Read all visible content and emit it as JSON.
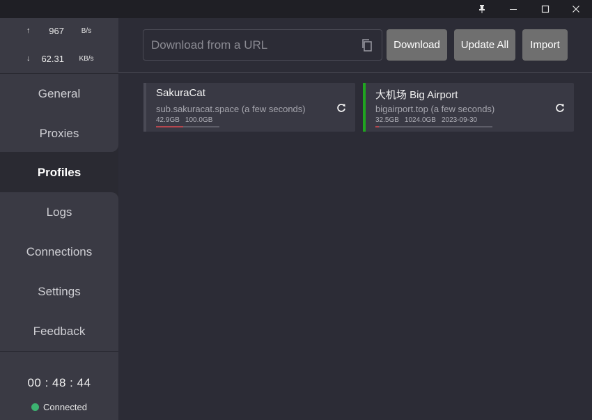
{
  "titlebar": {
    "icons": [
      "pin-icon",
      "minimize-icon",
      "maximize-icon",
      "close-icon"
    ]
  },
  "traffic": {
    "up_arrow": "↑",
    "up_value": "967",
    "up_unit": "B/s",
    "down_arrow": "↓",
    "down_value": "62.31",
    "down_unit": "KB/s"
  },
  "nav": {
    "items": [
      {
        "label": "General"
      },
      {
        "label": "Proxies"
      },
      {
        "label": "Profiles"
      },
      {
        "label": "Logs"
      },
      {
        "label": "Connections"
      },
      {
        "label": "Settings"
      },
      {
        "label": "Feedback"
      }
    ],
    "active": "Profiles"
  },
  "status": {
    "timer": "00 : 48 : 44",
    "connection": "Connected",
    "connection_color": "#3cb371"
  },
  "toolbar": {
    "url_placeholder": "Download from a URL",
    "download_label": "Download",
    "update_all_label": "Update All",
    "import_label": "Import"
  },
  "profiles": [
    {
      "name": "SakuraCat",
      "subtitle": "sub.sakuracat.space (a few seconds)",
      "used": "42.9GB",
      "total": "100.0GB",
      "expiry": "",
      "usage_fraction": 0.429,
      "active": false,
      "bar_color": "#4a4a55"
    },
    {
      "name": "大机场 Big Airport",
      "subtitle": "bigairport.top (a few seconds)",
      "used": "32.5GB",
      "total": "1024.0GB",
      "expiry": "2023-09-30",
      "usage_fraction": 0.032,
      "active": true,
      "bar_color": "#1fa51f"
    }
  ],
  "colors": {
    "usage_fill": "#b5474f",
    "accent_active": "#1fa51f"
  }
}
